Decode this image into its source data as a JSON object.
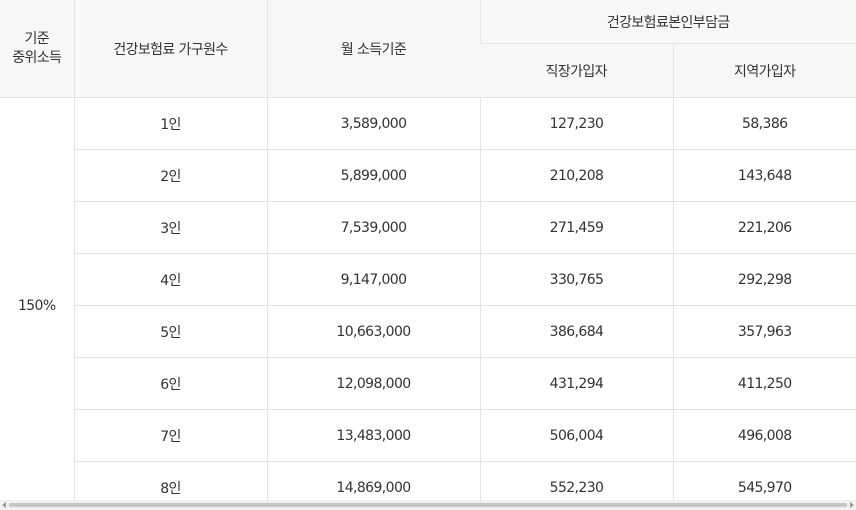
{
  "header": {
    "basis_line1": "기준",
    "basis_line2": "중위소득",
    "household": "건강보험료 가구원수",
    "monthly_income": "월 소득기준",
    "premium_group": "건강보험료본인부담금",
    "employee": "직장가입자",
    "regional": "지역가입자"
  },
  "basis_value": "150%",
  "rows": [
    {
      "household": "1인",
      "income": "3,589,000",
      "employee": "127,230",
      "regional": "58,386"
    },
    {
      "household": "2인",
      "income": "5,899,000",
      "employee": "210,208",
      "regional": "143,648"
    },
    {
      "household": "3인",
      "income": "7,539,000",
      "employee": "271,459",
      "regional": "221,206"
    },
    {
      "household": "4인",
      "income": "9,147,000",
      "employee": "330,765",
      "regional": "292,298"
    },
    {
      "household": "5인",
      "income": "10,663,000",
      "employee": "386,684",
      "regional": "357,963"
    },
    {
      "household": "6인",
      "income": "12,098,000",
      "employee": "431,294",
      "regional": "411,250"
    },
    {
      "household": "7인",
      "income": "13,483,000",
      "employee": "506,004",
      "regional": "496,008"
    },
    {
      "household": "8인",
      "income": "14,869,000",
      "employee": "552,230",
      "regional": "545,970"
    }
  ]
}
